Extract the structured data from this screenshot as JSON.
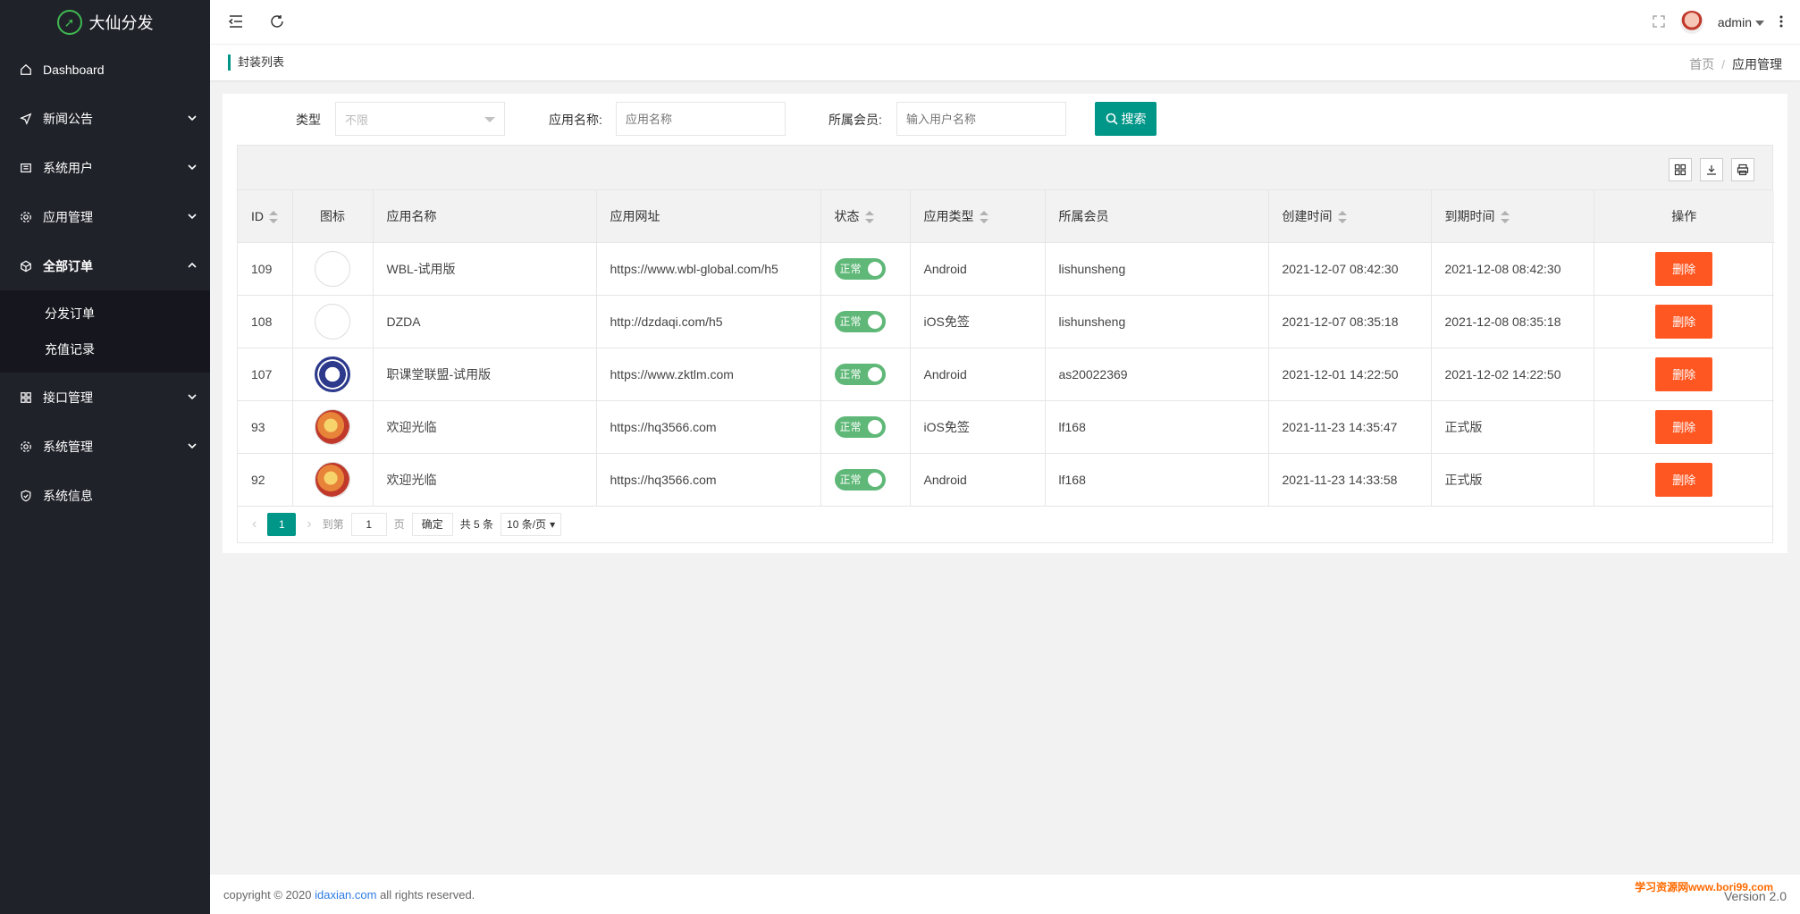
{
  "brand": {
    "name": "大仙分发"
  },
  "sidebar": {
    "items": [
      {
        "label": "Dashboard",
        "icon": "home-icon"
      },
      {
        "label": "新闻公告",
        "icon": "paper-plane-icon"
      },
      {
        "label": "系统用户",
        "icon": "users-icon"
      },
      {
        "label": "应用管理",
        "icon": "gear-icon"
      },
      {
        "label": "全部订单",
        "icon": "cube-icon"
      },
      {
        "label": "接口管理",
        "icon": "app-grid-icon"
      },
      {
        "label": "系统管理",
        "icon": "settings-icon"
      },
      {
        "label": "系统信息",
        "icon": "shield-icon"
      }
    ],
    "subitems": [
      "分发订单",
      "充值记录"
    ]
  },
  "header": {
    "user": "admin"
  },
  "breadcrumb": {
    "title": "封装列表",
    "home": "首页",
    "sep": "/",
    "current": "应用管理"
  },
  "filters": {
    "type_label": "类型",
    "type_value": "不限",
    "app_name_label": "应用名称:",
    "app_name_placeholder": "应用名称",
    "member_label": "所属会员:",
    "member_placeholder": "输入用户名称",
    "search_label": "搜索"
  },
  "table": {
    "columns": [
      "ID",
      "图标",
      "应用名称",
      "应用网址",
      "状态",
      "应用类型",
      "所属会员",
      "创建时间",
      "到期时间",
      "操作"
    ],
    "rows": [
      {
        "id": "109",
        "icon": "blank",
        "name": "WBL-试用版",
        "url": "https://www.wbl-global.com/h5",
        "status": "正常",
        "type": "Android",
        "member": "lishunsheng",
        "created": "2021-12-07 08:42:30",
        "expires": "2021-12-08 08:42:30",
        "action": "删除"
      },
      {
        "id": "108",
        "icon": "blank",
        "name": "DZDA",
        "url": "http://dzdaqi.com/h5",
        "status": "正常",
        "type": "iOS免签",
        "member": "lishunsheng",
        "created": "2021-12-07 08:35:18",
        "expires": "2021-12-08 08:35:18",
        "action": "删除"
      },
      {
        "id": "107",
        "icon": "seal",
        "name": "职课堂联盟-试用版",
        "url": "https://www.zktlm.com",
        "status": "正常",
        "type": "Android",
        "member": "as20022369",
        "created": "2021-12-01 14:22:50",
        "expires": "2021-12-02 14:22:50",
        "action": "删除"
      },
      {
        "id": "93",
        "icon": "globe",
        "name": "欢迎光临",
        "url": "https://hq3566.com",
        "status": "正常",
        "type": "iOS免签",
        "member": "lf168",
        "created": "2021-11-23 14:35:47",
        "expires": "正式版",
        "action": "删除"
      },
      {
        "id": "92",
        "icon": "globe",
        "name": "欢迎光临",
        "url": "https://hq3566.com",
        "status": "正常",
        "type": "Android",
        "member": "lf168",
        "created": "2021-11-23 14:33:58",
        "expires": "正式版",
        "action": "删除"
      }
    ]
  },
  "pager": {
    "current": "1",
    "goto_label": "到第",
    "goto_value": "1",
    "page_unit": "页",
    "confirm": "确定",
    "total": "共 5 条",
    "per_page": "10 条/页"
  },
  "footer": {
    "copyright_prefix": "copyright © 2020 ",
    "link": "idaxian.com",
    "copyright_suffix": " all rights reserved.",
    "watermark": "学习资源网www.bori99.com",
    "version": "Version 2.0"
  },
  "colors": {
    "accent": "#009688",
    "danger": "#ff5722",
    "switch_on": "#5fb878",
    "sidebar_bg": "#20222a"
  }
}
